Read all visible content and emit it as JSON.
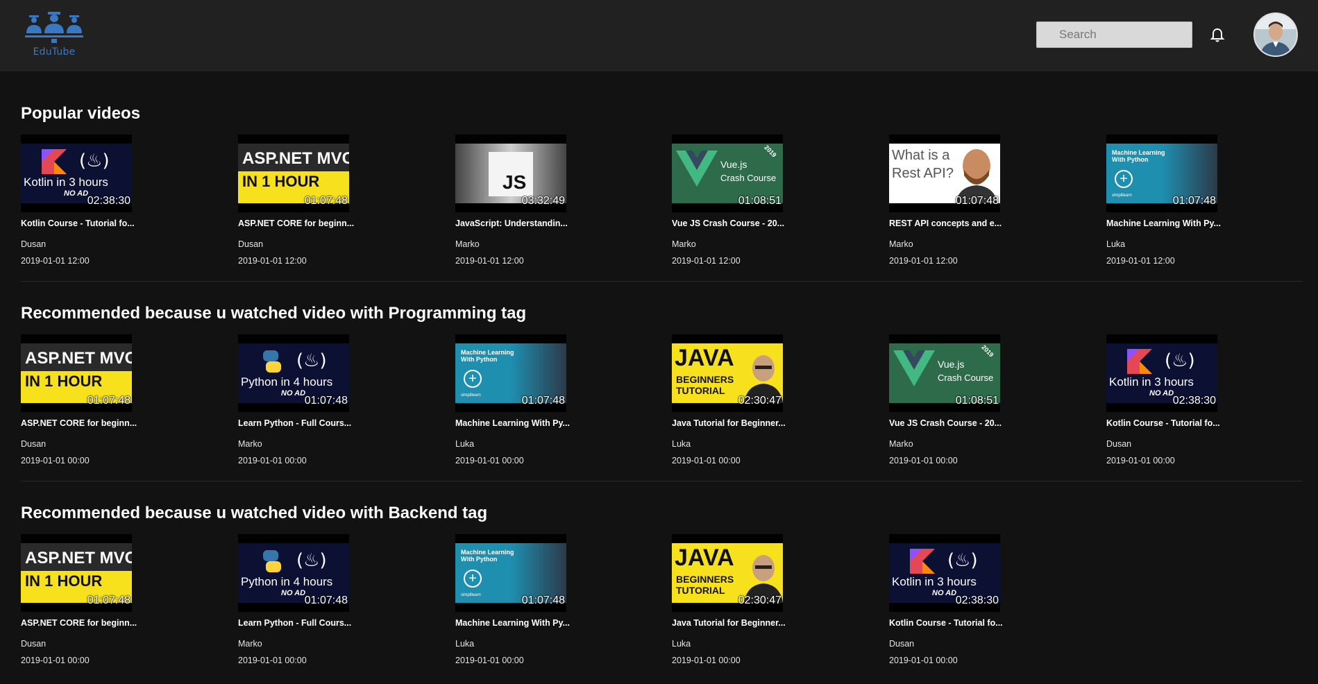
{
  "header": {
    "logo_text": "EduTube",
    "search_placeholder": "Search"
  },
  "sections": [
    {
      "title": "Popular videos",
      "videos": [
        {
          "thumb": "kotlin",
          "duration": "02:38:30",
          "title": "Kotlin Course - Tutorial fo...",
          "channel": "Dusan",
          "date": "2019-01-01 12:00"
        },
        {
          "thumb": "aspnet",
          "duration": "01:07:48",
          "title": "ASP.NET CORE for beginn...",
          "channel": "Dusan",
          "date": "2019-01-01 12:00"
        },
        {
          "thumb": "js",
          "duration": "03:32:49",
          "title": "JavaScript: Understandin...",
          "channel": "Marko",
          "date": "2019-01-01 12:00"
        },
        {
          "thumb": "vue",
          "duration": "01:08:51",
          "title": "Vue JS Crash Course - 20...",
          "channel": "Marko",
          "date": "2019-01-01 12:00"
        },
        {
          "thumb": "rest",
          "duration": "01:07:48",
          "title": "REST API concepts and e...",
          "channel": "Marko",
          "date": "2019-01-01 12:00"
        },
        {
          "thumb": "ml",
          "duration": "01:07:48",
          "title": "Machine Learning With Py...",
          "channel": "Luka",
          "date": "2019-01-01 12:00"
        }
      ]
    },
    {
      "title": "Recommended because u watched video with Programming tag",
      "videos": [
        {
          "thumb": "aspnet",
          "duration": "01:07:48",
          "title": "ASP.NET CORE for beginn...",
          "channel": "Dusan",
          "date": "2019-01-01 00:00"
        },
        {
          "thumb": "python",
          "duration": "01:07:48",
          "title": "Learn Python - Full Cours...",
          "channel": "Marko",
          "date": "2019-01-01 00:00"
        },
        {
          "thumb": "ml",
          "duration": "01:07:48",
          "title": "Machine Learning With Py...",
          "channel": "Luka",
          "date": "2019-01-01 00:00"
        },
        {
          "thumb": "java",
          "duration": "02:30:47",
          "title": "Java Tutorial for Beginner...",
          "channel": "Luka",
          "date": "2019-01-01 00:00"
        },
        {
          "thumb": "vue",
          "duration": "01:08:51",
          "title": "Vue JS Crash Course - 20...",
          "channel": "Marko",
          "date": "2019-01-01 00:00"
        },
        {
          "thumb": "kotlin",
          "duration": "02:38:30",
          "title": "Kotlin Course - Tutorial fo...",
          "channel": "Dusan",
          "date": "2019-01-01 00:00"
        }
      ]
    },
    {
      "title": "Recommended because u watched video with Backend tag",
      "videos": [
        {
          "thumb": "aspnet",
          "duration": "01:07:48",
          "title": "ASP.NET CORE for beginn...",
          "channel": "Dusan",
          "date": "2019-01-01 00:00"
        },
        {
          "thumb": "python",
          "duration": "01:07:48",
          "title": "Learn Python - Full Cours...",
          "channel": "Marko",
          "date": "2019-01-01 00:00"
        },
        {
          "thumb": "ml",
          "duration": "01:07:48",
          "title": "Machine Learning With Py...",
          "channel": "Luka",
          "date": "2019-01-01 00:00"
        },
        {
          "thumb": "java",
          "duration": "02:30:47",
          "title": "Java Tutorial for Beginner...",
          "channel": "Luka",
          "date": "2019-01-01 00:00"
        },
        {
          "thumb": "kotlin",
          "duration": "02:38:30",
          "title": "Kotlin Course - Tutorial fo...",
          "channel": "Dusan",
          "date": "2019-01-01 00:00"
        }
      ]
    }
  ],
  "thumb_text": {
    "kotlin": {
      "line1": "Kotlin in 3 hours",
      "line2": "NO AD"
    },
    "aspnet": {
      "line1": "ASP.NET MVC",
      "line2": "IN 1 HOUR"
    },
    "js": {
      "line1": "JS"
    },
    "vue": {
      "line1": "Vue.js",
      "line2": "Crash Course",
      "badge": "2019"
    },
    "rest": {
      "line1": "What is a",
      "line2": "Rest API?"
    },
    "ml": {
      "line1": "Machine Learning",
      "line2": "With Python",
      "brand": "simplilearn"
    },
    "python": {
      "line1": "Python in 4 hours",
      "line2": "NO AD"
    },
    "java": {
      "line1": "JAVA",
      "line2": "BEGINNERS",
      "line3": "TUTORIAL"
    }
  },
  "colors": {
    "background": "#121212",
    "topbar": "#212121",
    "logo_blue": "#3a78c4"
  }
}
